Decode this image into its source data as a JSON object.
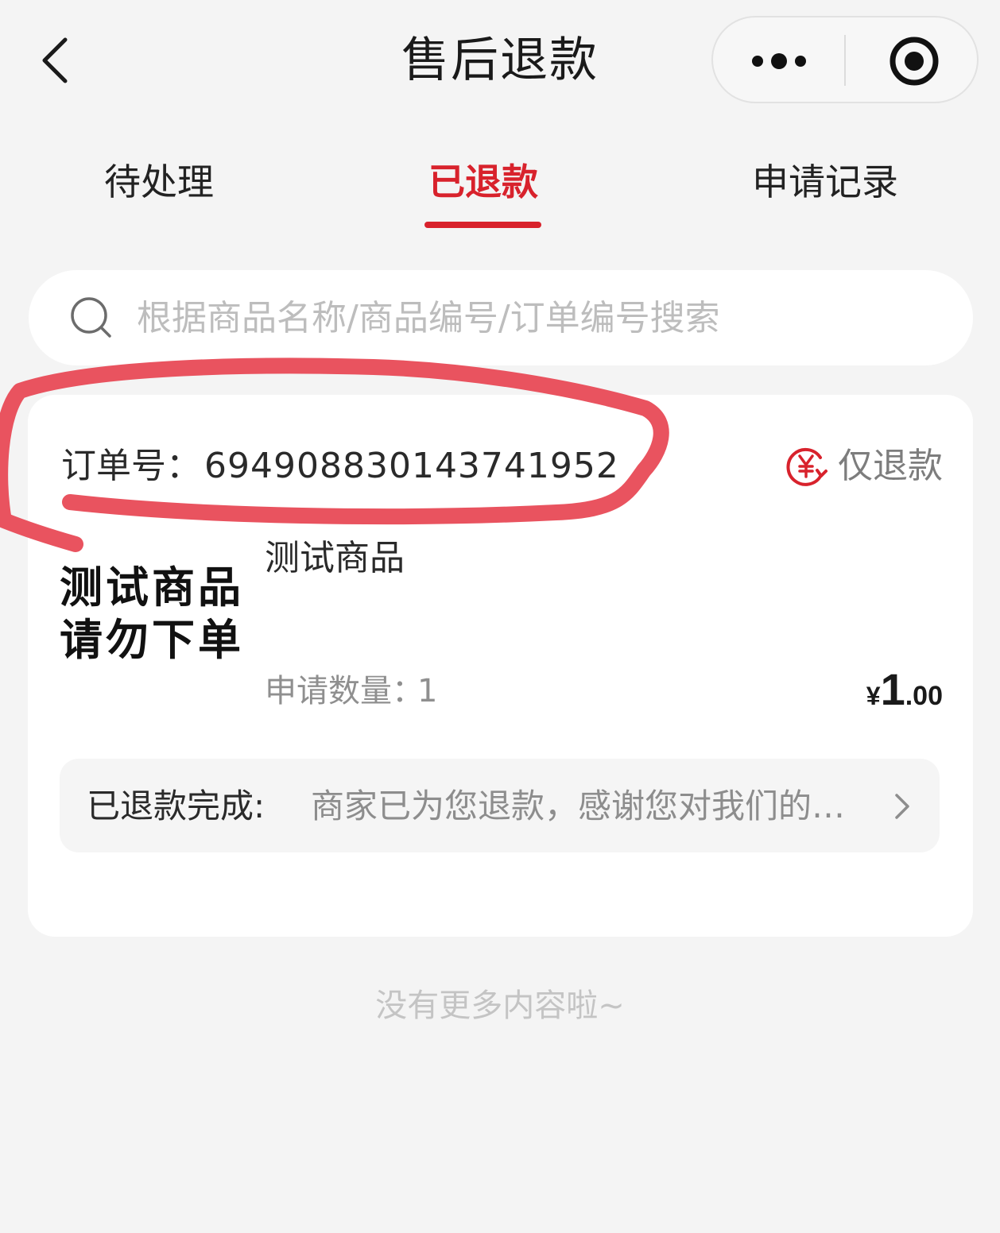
{
  "header": {
    "title": "售后退款",
    "back_icon": "chevron-left-icon",
    "more_icon": "more-dots-icon",
    "close_icon": "target-icon"
  },
  "tabs": [
    {
      "label": "待处理",
      "active": false
    },
    {
      "label": "已退款",
      "active": true
    },
    {
      "label": "申请记录",
      "active": false
    }
  ],
  "search": {
    "placeholder": "根据商品名称/商品编号/订单编号搜索",
    "icon": "search-icon"
  },
  "order": {
    "number_label": "订单号：",
    "number": "6949088301437419​52",
    "refund_type": "仅退款",
    "refund_type_icon": "yen-refund-icon",
    "thumbnail_text_line1": "测试商品",
    "thumbnail_text_line2": "请勿下单",
    "product_name": "测试商品",
    "apply_qty_label": "申请数量：",
    "apply_qty": "1",
    "price_currency": "¥",
    "price_integer": "1",
    "price_decimal": ".00",
    "status_label": "已退款完成:",
    "status_message": "商家已为您退款，感谢您对我们的…"
  },
  "footer": {
    "note": "没有更多内容啦~"
  },
  "colors": {
    "accent": "#d8222c",
    "annotation": "#e84a56",
    "background": "#f4f4f4"
  }
}
